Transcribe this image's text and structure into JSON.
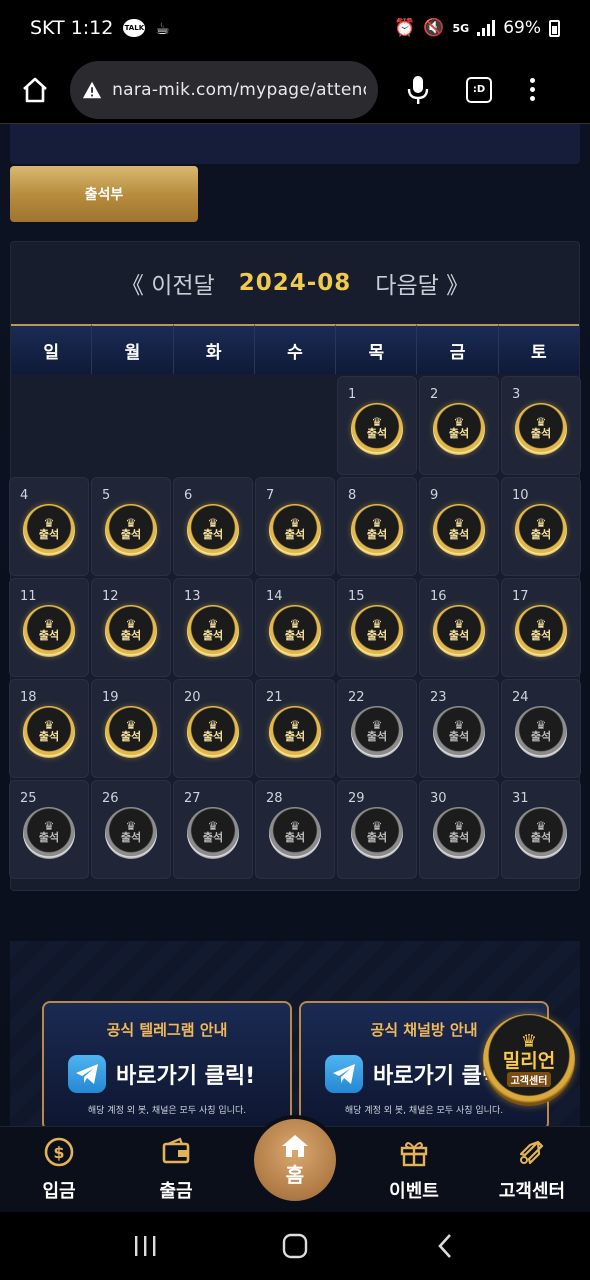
{
  "status_bar": {
    "carrier_time": "SKT 1:12",
    "talk_label": "TALK",
    "network": "5G",
    "battery": "69%"
  },
  "browser": {
    "url": "nara-mik.com/mypage/attend.p",
    "tabs_label": ":D"
  },
  "page": {
    "tab_label": "출석부"
  },
  "calendar": {
    "prev_label": "《 이전달",
    "month": "2024-08",
    "next_label": "다음달 》",
    "weekdays": [
      "일",
      "월",
      "화",
      "수",
      "목",
      "금",
      "토"
    ],
    "stamp_label": "출석",
    "first_weekday_index": 4,
    "days": [
      {
        "day": "1",
        "attended": true
      },
      {
        "day": "2",
        "attended": true
      },
      {
        "day": "3",
        "attended": true
      },
      {
        "day": "4",
        "attended": true
      },
      {
        "day": "5",
        "attended": true
      },
      {
        "day": "6",
        "attended": true
      },
      {
        "day": "7",
        "attended": true
      },
      {
        "day": "8",
        "attended": true
      },
      {
        "day": "9",
        "attended": true
      },
      {
        "day": "10",
        "attended": true
      },
      {
        "day": "11",
        "attended": true
      },
      {
        "day": "12",
        "attended": true
      },
      {
        "day": "13",
        "attended": true
      },
      {
        "day": "14",
        "attended": true
      },
      {
        "day": "15",
        "attended": true
      },
      {
        "day": "16",
        "attended": true
      },
      {
        "day": "17",
        "attended": true
      },
      {
        "day": "18",
        "attended": true
      },
      {
        "day": "19",
        "attended": true
      },
      {
        "day": "20",
        "attended": true
      },
      {
        "day": "21",
        "attended": true
      },
      {
        "day": "22",
        "attended": false
      },
      {
        "day": "23",
        "attended": false
      },
      {
        "day": "24",
        "attended": false
      },
      {
        "day": "25",
        "attended": false
      },
      {
        "day": "26",
        "attended": false
      },
      {
        "day": "27",
        "attended": false
      },
      {
        "day": "28",
        "attended": false
      },
      {
        "day": "29",
        "attended": false
      },
      {
        "day": "30",
        "attended": false
      },
      {
        "day": "31",
        "attended": false
      }
    ]
  },
  "banners": {
    "telegram": {
      "title": "공식 텔레그램 안내",
      "cta": "바로가기 클릭!",
      "note": "해당 계정 외 봇, 채널은 모두 사칭 입니다."
    },
    "channel": {
      "title": "공식 채널방 안내",
      "cta": "바로가기 클릭!",
      "note": "해당 계정 외 봇, 채널은 모두 사칭 입니다."
    }
  },
  "support_badge": {
    "brand": "밀리언",
    "sub": "고객센터"
  },
  "bottom_nav": {
    "deposit": "입금",
    "withdraw": "출금",
    "home": "홈",
    "event": "이벤트",
    "support": "고객센터"
  },
  "colors": {
    "accent_gold": "#f0c94f",
    "tab_gold": "#c89a4a",
    "background": "#0d1120"
  }
}
